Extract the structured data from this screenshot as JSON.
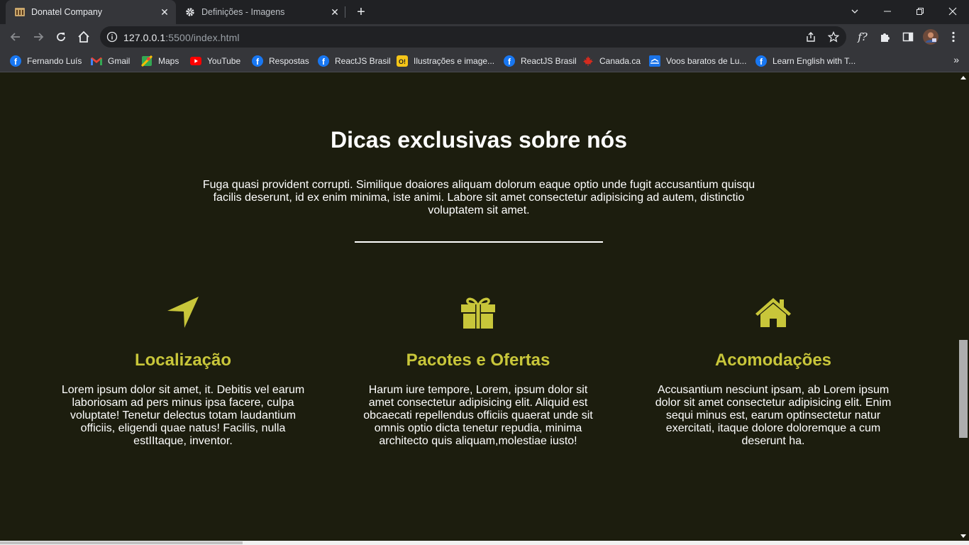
{
  "browser": {
    "tabs": [
      {
        "title": "Donatel Company",
        "icon": "site-favicon",
        "active": true
      },
      {
        "title": "Definições - Imagens",
        "icon": "gear-icon",
        "active": false
      }
    ],
    "url_host": "127.0.0.1",
    "url_rest": ":5500/index.html",
    "bookmarks": [
      {
        "label": "Fernando Luís",
        "icon": "facebook-icon"
      },
      {
        "label": "Gmail",
        "icon": "gmail-icon"
      },
      {
        "label": "Maps",
        "icon": "maps-icon"
      },
      {
        "label": "YouTube",
        "icon": "youtube-icon"
      },
      {
        "label": "Respostas",
        "icon": "facebook-icon"
      },
      {
        "label": "ReactJS Brasil",
        "icon": "facebook-icon"
      },
      {
        "label": "Ilustrações e image...",
        "icon": "illustration-icon"
      },
      {
        "label": "ReactJS Brasil",
        "icon": "facebook-icon"
      },
      {
        "label": "Canada.ca",
        "icon": "maple-leaf-icon"
      },
      {
        "label": "Voos baratos de Lu...",
        "icon": "flights-icon"
      },
      {
        "label": "Learn English with T...",
        "icon": "facebook-icon"
      }
    ],
    "bookmarks_more": "»",
    "extension_text": "f?"
  },
  "page": {
    "title": "Dicas exclusivas sobre nós",
    "intro": "Fuga quasi provident corrupti. Similique doaiores aliquam dolorum eaque optio unde fugit accusantium quisqu facilis deserunt, id ex enim minima, iste animi. Labore sit amet consectetur adipisicing ad autem, distinctio voluptatem sit amet.",
    "accent_color": "#c8c63a",
    "background_color": "#1c1d0e",
    "features": [
      {
        "icon": "location-arrow-icon",
        "title": "Localização",
        "text": "Lorem ipsum dolor sit amet, it. Debitis vel earum laboriosam ad pers minus ipsa facere, culpa voluptate! Tenetur delectus totam laudantium officiis, eligendi quae natus! Facilis, nulla estIItaque, inventor."
      },
      {
        "icon": "gift-icon",
        "title": "Pacotes e Ofertas",
        "text": "Harum iure tempore, Lorem, ipsum dolor sit amet consectetur adipisicing elit. Aliquid est obcaecati repellendus officiis quaerat unde sit omnis optio dicta tenetur repudia, minima architecto quis aliquam,molestiae iusto!"
      },
      {
        "icon": "home-icon",
        "title": "Acomodações",
        "text": "Accusantium nesciunt ipsam, ab Lorem ipsum dolor sit amet consectetur adipisicing elit. Enim sequi minus est, earum optinsectetur natur exercitati, itaque dolore doloremque a cum deserunt ha."
      }
    ]
  }
}
